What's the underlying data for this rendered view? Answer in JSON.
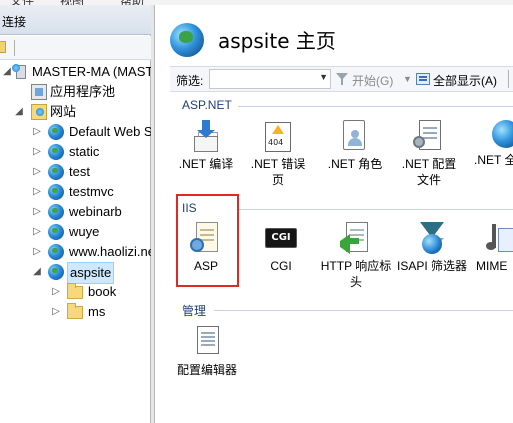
{
  "menubar": {
    "items": [
      "文件",
      "视图",
      "帮助"
    ]
  },
  "left": {
    "header": "连接",
    "tree": [
      {
        "label": "MASTER-MA (MASTER-MA",
        "kind": "server"
      },
      {
        "label": "应用程序池",
        "kind": "apppool"
      },
      {
        "label": "网站",
        "kind": "sites"
      },
      {
        "label": "Default Web S",
        "kind": "site"
      },
      {
        "label": "static",
        "kind": "site"
      },
      {
        "label": "test",
        "kind": "site"
      },
      {
        "label": "testmvc",
        "kind": "site"
      },
      {
        "label": "webinarb",
        "kind": "site"
      },
      {
        "label": "wuye",
        "kind": "site"
      },
      {
        "label": "www.haolizi.ne",
        "kind": "site"
      },
      {
        "label": "aspsite",
        "kind": "site",
        "selected": true
      },
      {
        "label": "book",
        "kind": "folder"
      },
      {
        "label": "ms",
        "kind": "folder"
      }
    ]
  },
  "right": {
    "title": "aspsite 主页",
    "filter": {
      "label": "筛选:",
      "value": "",
      "start": "开始(G)",
      "show_all": "全部显示(A)"
    },
    "groups": {
      "aspnet": "ASP.NET",
      "iis": "IIS",
      "manage": "管理"
    },
    "aspnet_items": [
      ".NET 编译",
      ".NET 错误页",
      ".NET 角色",
      ".NET 配置文件",
      ".NET 全"
    ],
    "iis_items": [
      "ASP",
      "CGI",
      "HTTP 响应标头",
      "ISAPI 筛选器",
      "MIME"
    ],
    "manage_items": [
      "配置编辑器"
    ]
  }
}
